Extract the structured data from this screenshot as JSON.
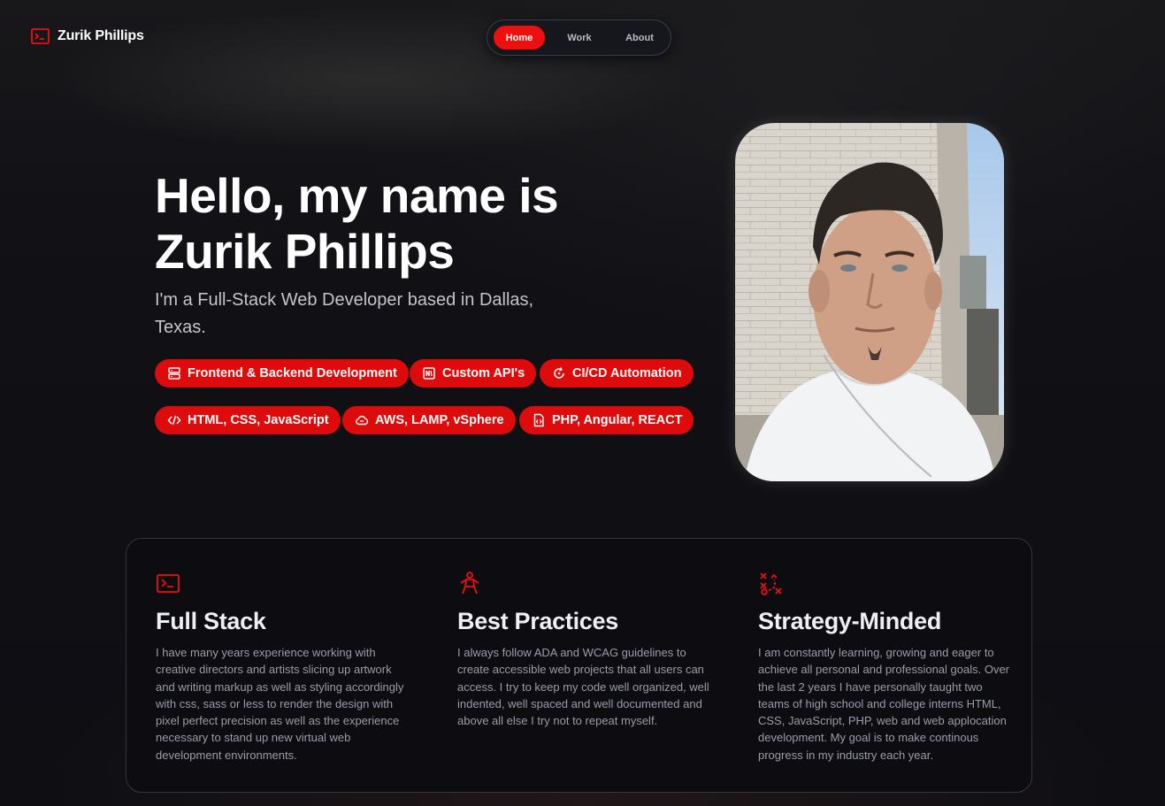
{
  "brand": {
    "name": "Zurik Phillips",
    "icon": "terminal-icon",
    "accent_color": "#ee0f0f"
  },
  "nav": {
    "items": [
      {
        "label": "Home",
        "active": true
      },
      {
        "label": "Work",
        "active": false
      },
      {
        "label": "About",
        "active": false
      }
    ]
  },
  "hero": {
    "title_line1": "Hello, my name is",
    "title_line2": "Zurik Phillips",
    "subtitle": "I'm a Full-Stack Web Developer based in Dallas, Texas.",
    "skills": [
      {
        "label": "Frontend & Backend Development",
        "icon": "server-icon"
      },
      {
        "label": "Custom API's",
        "icon": "api-icon"
      },
      {
        "label": "CI/CD Automation",
        "icon": "refresh-icon"
      },
      {
        "label": "HTML, CSS, JavaScript",
        "icon": "code-icon"
      },
      {
        "label": "AWS, LAMP, vSphere",
        "icon": "cloud-icon"
      },
      {
        "label": "PHP, Angular, REACT",
        "icon": "file-code-icon"
      }
    ]
  },
  "features": [
    {
      "icon": "terminal-icon",
      "title": "Full Stack",
      "body": "I have many years experience working with creative directors and artists slicing up artwork and writing markup as well as styling accordingly with css, sass or less to render the design with pixel perfect precision as well as the experience necessary to stand up new virtual web development environments."
    },
    {
      "icon": "accessibility-icon",
      "title": "Best Practices",
      "body": "I always follow ADA and WCAG guidelines to create accessible web projects that all users can access. I try to keep my code well organized, well indented, well spaced and well documented and above all else I try not to repeat myself."
    },
    {
      "icon": "strategy-icon",
      "title": "Strategy-Minded",
      "body": "I am constantly learning, growing and eager to achieve all personal and professional goals. Over the last 2 years I have personally taught two teams of high school and college interns HTML, CSS, JavaScript, PHP, web and web applocation development. My goal is to make continous progress in my industry each year."
    }
  ]
}
